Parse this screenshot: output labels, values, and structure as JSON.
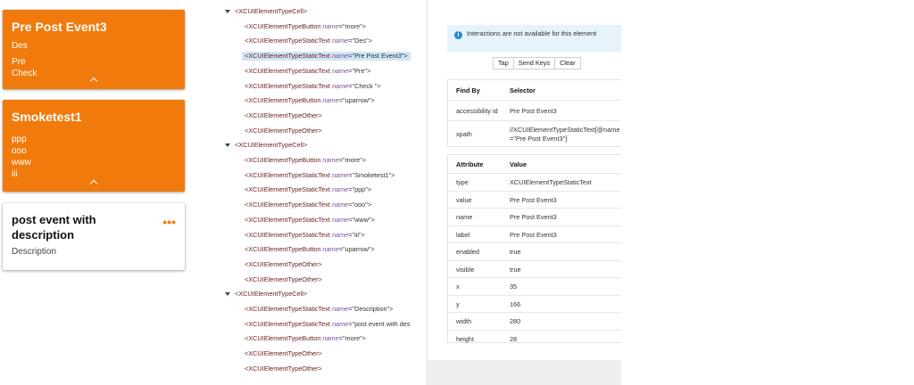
{
  "preview": {
    "cards": [
      {
        "title": "Pre Post Event3",
        "lines": [
          "Des",
          "Pre",
          "Check"
        ]
      },
      {
        "title": "Smoketest1",
        "lines": [
          "ppp",
          "ooo",
          "www",
          "iii"
        ]
      },
      {
        "title": "post event with description",
        "subtitle": "Description",
        "more_label": "•••"
      }
    ],
    "accent_color": "#f07b0c"
  },
  "tree": {
    "nodes": [
      {
        "depth": 0,
        "tag": "<XCUIElementTypeCell>",
        "attr": "",
        "value": "",
        "expandable": true
      },
      {
        "depth": 1,
        "tag": "<XCUIElementTypeButton",
        "attr": "name",
        "value": "=\"more\">"
      },
      {
        "depth": 1,
        "tag": "<XCUIElementTypeStaticText",
        "attr": "name",
        "value": "=\"Des\">"
      },
      {
        "depth": 1,
        "tag": "<XCUIElementTypeStaticText",
        "attr": "name",
        "value": "=\"Pre Post Event3\">",
        "selected": true
      },
      {
        "depth": 1,
        "tag": "<XCUIElementTypeStaticText",
        "attr": "name",
        "value": "=\"Pre\">"
      },
      {
        "depth": 1,
        "tag": "<XCUIElementTypeStaticText",
        "attr": "name",
        "value": "=\"Check \">"
      },
      {
        "depth": 1,
        "tag": "<XCUIElementTypeButton",
        "attr": "name",
        "value": "=\"uparrow\">"
      },
      {
        "depth": 1,
        "tag": "<XCUIElementTypeOther>",
        "attr": "",
        "value": ""
      },
      {
        "depth": 1,
        "tag": "<XCUIElementTypeOther>",
        "attr": "",
        "value": ""
      },
      {
        "depth": 0,
        "tag": "<XCUIElementTypeCell>",
        "attr": "",
        "value": "",
        "expandable": true
      },
      {
        "depth": 1,
        "tag": "<XCUIElementTypeButton",
        "attr": "name",
        "value": "=\"more\">"
      },
      {
        "depth": 1,
        "tag": "<XCUIElementTypeStaticText",
        "attr": "name",
        "value": "=\"Smoketest1\">"
      },
      {
        "depth": 1,
        "tag": "<XCUIElementTypeStaticText",
        "attr": "name",
        "value": "=\"ppp\">"
      },
      {
        "depth": 1,
        "tag": "<XCUIElementTypeStaticText",
        "attr": "name",
        "value": "=\"ooo\">"
      },
      {
        "depth": 1,
        "tag": "<XCUIElementTypeStaticText",
        "attr": "name",
        "value": "=\"www\">"
      },
      {
        "depth": 1,
        "tag": "<XCUIElementTypeStaticText",
        "attr": "name",
        "value": "=\"iii\">"
      },
      {
        "depth": 1,
        "tag": "<XCUIElementTypeButton",
        "attr": "name",
        "value": "=\"uparrow\">"
      },
      {
        "depth": 1,
        "tag": "<XCUIElementTypeOther>",
        "attr": "",
        "value": ""
      },
      {
        "depth": 1,
        "tag": "<XCUIElementTypeOther>",
        "attr": "",
        "value": ""
      },
      {
        "depth": 0,
        "tag": "<XCUIElementTypeCell>",
        "attr": "",
        "value": "",
        "expandable": true
      },
      {
        "depth": 1,
        "tag": "<XCUIElementTypeStaticText",
        "attr": "name",
        "value": "=\"Description\">"
      },
      {
        "depth": 1,
        "tag": "<XCUIElementTypeStaticText",
        "attr": "name",
        "value": "=\"post event with des"
      },
      {
        "depth": 1,
        "tag": "<XCUIElementTypeButton",
        "attr": "name",
        "value": "=\"more\">"
      },
      {
        "depth": 1,
        "tag": "<XCUIElementTypeOther>",
        "attr": "",
        "value": ""
      },
      {
        "depth": 1,
        "tag": "<XCUIElementTypeOther>",
        "attr": "",
        "value": ""
      }
    ]
  },
  "inspector": {
    "info_message": "Interactions are not available for this element",
    "actions": [
      "Tap",
      "Send Keys",
      "Clear"
    ],
    "selectors": {
      "headers": [
        "Find By",
        "Selector"
      ],
      "rows": [
        [
          "accessibility id",
          "Pre Post Event3"
        ],
        [
          "xpath",
          "//XCUIElementTypeStaticText[@name=\"Pre Post Event3\"]"
        ]
      ]
    },
    "attributes": {
      "headers": [
        "Attribute",
        "Value"
      ],
      "rows": [
        [
          "type",
          "XCUIElementTypeStaticText"
        ],
        [
          "value",
          "Pre Post Event3"
        ],
        [
          "name",
          "Pre Post Event3"
        ],
        [
          "label",
          "Pre Post Event3"
        ],
        [
          "enabled",
          "true"
        ],
        [
          "visible",
          "true"
        ],
        [
          "x",
          "35"
        ],
        [
          "y",
          "166"
        ],
        [
          "width",
          "280"
        ],
        [
          "height",
          "28"
        ]
      ]
    }
  }
}
